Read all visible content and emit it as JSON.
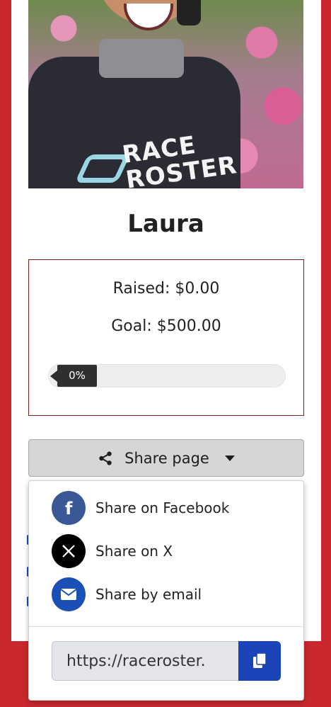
{
  "profile": {
    "name": "Laura",
    "photo_logo_text_1": "RACE",
    "photo_logo_text_2": "ROSTER"
  },
  "fundraising": {
    "raised_label": "Raised: $0.00",
    "goal_label": "Goal: $500.00",
    "progress_label": "0%",
    "progress_fraction": 0
  },
  "share": {
    "button_label": "Share page",
    "menu": [
      {
        "label": "Share on Facebook",
        "icon": "facebook-icon",
        "color": "#3b5896"
      },
      {
        "label": "Share on X",
        "icon": "x-icon",
        "color": "#000000"
      },
      {
        "label": "Share by email",
        "icon": "email-icon",
        "color": "#1a4fb5"
      }
    ],
    "url_value": "https://raceroster.",
    "copy_icon": "copy-icon"
  },
  "colors": {
    "background": "#c9282d",
    "accent": "#1a44b8",
    "progress": "#2f2f2f"
  }
}
